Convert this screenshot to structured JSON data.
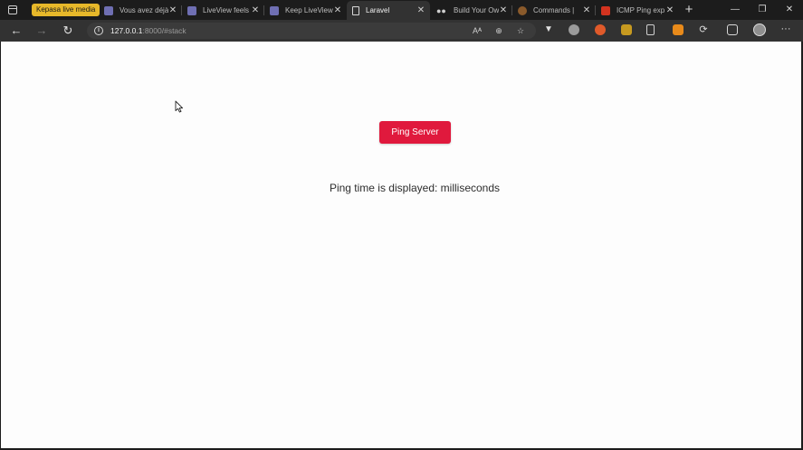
{
  "browser": {
    "pinned_tab": "Kepasa live media",
    "tabs": [
      {
        "title": "Vous avez déjà",
        "favicon_color": "#6f6fb3"
      },
      {
        "title": "LiveView feels",
        "favicon_color": "#6f6fb3"
      },
      {
        "title": "Keep LiveView",
        "favicon_color": "#6f6fb3"
      },
      {
        "title": "Laravel",
        "favicon_color": "#d8d8d8"
      },
      {
        "title": "Build Your Own",
        "favicon_color": "#cfcfcf"
      },
      {
        "title": "Commands |",
        "favicon_color": "#8a5a2b"
      },
      {
        "title": "ICMP Ping exp",
        "favicon_color": "#d3331f"
      }
    ],
    "active_tab_index": 3,
    "new_tab_icon": "+",
    "window_controls": {
      "minimize": "—",
      "restore": "❐",
      "close": "✕"
    },
    "address": {
      "host": "127.0.0.1",
      "path": ":8000/#stack"
    }
  },
  "page": {
    "button_label": "Ping Server",
    "ping_text": "Ping time is displayed: milliseconds"
  },
  "colors": {
    "button": "#e0193d",
    "pinned_tab": "#e7b82a",
    "page_background": "#fdfdfd",
    "chrome_dark": "#1c1c1c",
    "toolbar": "#323232"
  }
}
